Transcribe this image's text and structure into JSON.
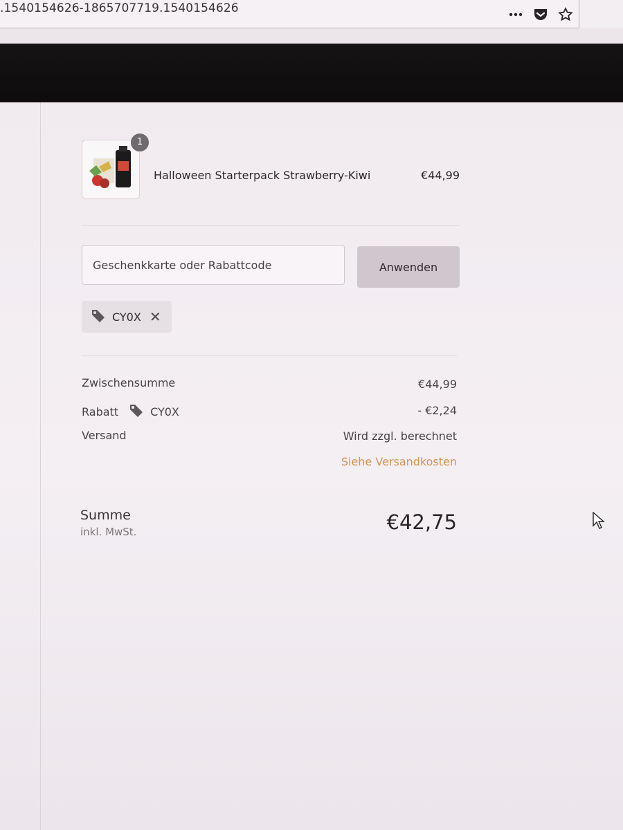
{
  "browser": {
    "url": ".1540154626-1865707719.1540154626",
    "icons": [
      "more-icon",
      "pocket-icon",
      "bookmark-star-icon"
    ]
  },
  "cart": {
    "item": {
      "name": "Halloween Starterpack Strawberry-Kiwi",
      "price": "€44,99",
      "quantity": "1"
    },
    "discount_input": {
      "placeholder": "Geschenkkarte oder Rabattcode",
      "value": ""
    },
    "apply_label": "Anwenden",
    "applied_code": "CY0X"
  },
  "summary": {
    "subtotal_label": "Zwischensumme",
    "subtotal_value": "€44,99",
    "discount_label": "Rabatt",
    "discount_code": "CY0X",
    "discount_value": "- €2,24",
    "shipping_label": "Versand",
    "shipping_value": "Wird zzgl. berechnet",
    "shipping_link": "Siehe Versandkosten",
    "total_label": "Summe",
    "total_sub": "inkl. MwSt.",
    "total_value": "€42,75"
  },
  "colors": {
    "header_bg": "#0f0c0e",
    "page_bg": "#f3eef2",
    "link": "#d19552",
    "button_bg": "#cfc7cd"
  }
}
